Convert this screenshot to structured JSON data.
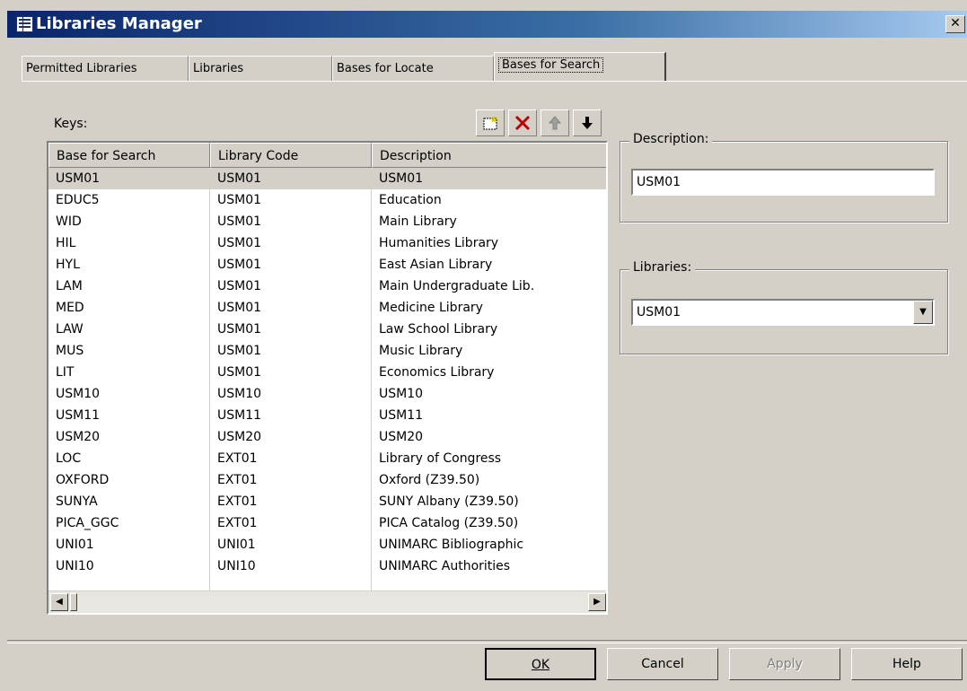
{
  "window": {
    "title": "Libraries Manager",
    "close_glyph": "✕"
  },
  "tabs": [
    {
      "label": "Permitted Libraries"
    },
    {
      "label": "Libraries"
    },
    {
      "label": "Bases for Locate"
    },
    {
      "label": "Bases for Search"
    }
  ],
  "keys_label": "Keys:",
  "toolbar": {
    "icons": [
      "new-row-icon",
      "delete-icon",
      "arrow-up-icon",
      "arrow-down-icon"
    ]
  },
  "grid": {
    "columns": [
      "Base for Search",
      "Library Code",
      "Description"
    ],
    "rows": [
      [
        "USM01",
        "USM01",
        "USM01"
      ],
      [
        "EDUC5",
        "USM01",
        "Education"
      ],
      [
        "WID",
        "USM01",
        "Main Library"
      ],
      [
        "HIL",
        "USM01",
        "Humanities Library"
      ],
      [
        "HYL",
        "USM01",
        "East Asian Library"
      ],
      [
        "LAM",
        "USM01",
        "Main Undergraduate Lib."
      ],
      [
        "MED",
        "USM01",
        "Medicine Library"
      ],
      [
        "LAW",
        "USM01",
        "Law School Library"
      ],
      [
        "MUS",
        "USM01",
        "Music Library"
      ],
      [
        "LIT",
        "USM01",
        "Economics Library"
      ],
      [
        "USM10",
        "USM10",
        "USM10"
      ],
      [
        "USM11",
        "USM11",
        "USM11"
      ],
      [
        "USM20",
        "USM20",
        "USM20"
      ],
      [
        "LOC",
        "EXT01",
        "Library of Congress"
      ],
      [
        "OXFORD",
        "EXT01",
        "Oxford (Z39.50)"
      ],
      [
        "SUNYA",
        "EXT01",
        "SUNY Albany (Z39.50)"
      ],
      [
        "PICA_GGC",
        "EXT01",
        "PICA Catalog (Z39.50)"
      ],
      [
        "UNI01",
        "UNI01",
        "UNIMARC Bibliographic"
      ],
      [
        "UNI10",
        "UNI10",
        "UNIMARC Authorities"
      ],
      [
        "",
        "",
        ""
      ]
    ]
  },
  "description_group": {
    "legend": "Description:",
    "value": "USM01"
  },
  "libraries_group": {
    "legend": "Libraries:",
    "value": "USM01"
  },
  "buttons": {
    "ok": "OK",
    "cancel": "Cancel",
    "apply": "Apply",
    "help": "Help"
  }
}
